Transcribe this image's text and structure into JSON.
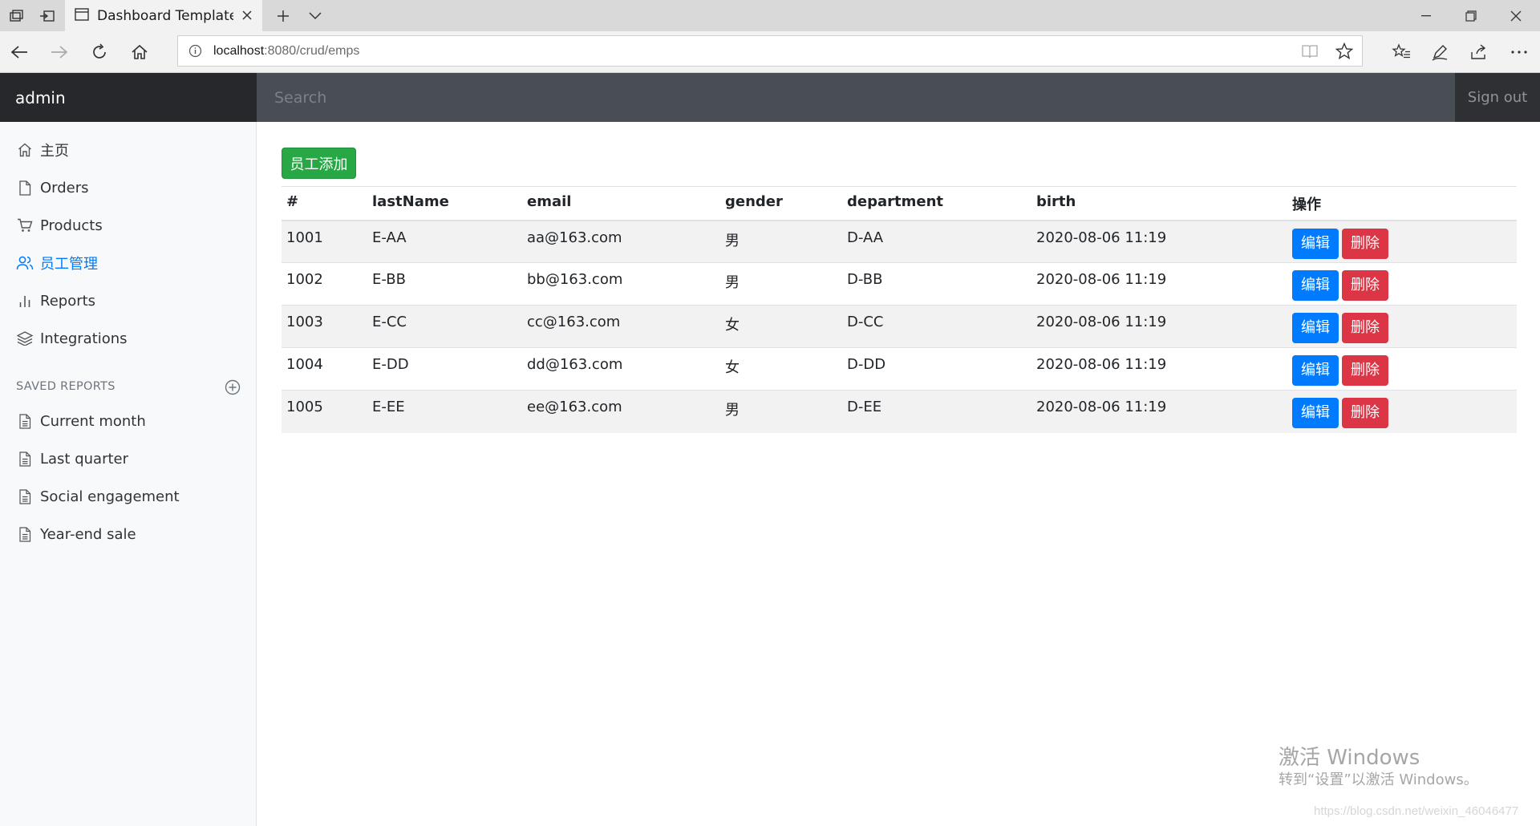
{
  "browser": {
    "tab_title": "Dashboard Template fo",
    "url_host": "localhost",
    "url_path": ":8080/crud/emps"
  },
  "header": {
    "brand": "admin",
    "search_placeholder": "Search",
    "signout": "Sign out"
  },
  "sidebar": {
    "items": [
      {
        "label": "主页",
        "icon": "home-icon"
      },
      {
        "label": "Orders",
        "icon": "file-icon"
      },
      {
        "label": "Products",
        "icon": "cart-icon"
      },
      {
        "label": "员工管理",
        "icon": "users-icon",
        "active": true
      },
      {
        "label": "Reports",
        "icon": "bar-chart-icon"
      },
      {
        "label": "Integrations",
        "icon": "layers-icon"
      }
    ],
    "saved_heading": "SAVED REPORTS",
    "saved": [
      {
        "label": "Current month"
      },
      {
        "label": "Last quarter"
      },
      {
        "label": "Social engagement"
      },
      {
        "label": "Year-end sale"
      }
    ]
  },
  "main": {
    "add_button": "员工添加",
    "columns": [
      "#",
      "lastName",
      "email",
      "gender",
      "department",
      "birth",
      "操作"
    ],
    "rows": [
      {
        "id": "1001",
        "lastName": "E-AA",
        "email": "aa@163.com",
        "gender": "男",
        "department": "D-AA",
        "birth": "2020-08-06 11:19"
      },
      {
        "id": "1002",
        "lastName": "E-BB",
        "email": "bb@163.com",
        "gender": "男",
        "department": "D-BB",
        "birth": "2020-08-06 11:19"
      },
      {
        "id": "1003",
        "lastName": "E-CC",
        "email": "cc@163.com",
        "gender": "女",
        "department": "D-CC",
        "birth": "2020-08-06 11:19"
      },
      {
        "id": "1004",
        "lastName": "E-DD",
        "email": "dd@163.com",
        "gender": "女",
        "department": "D-DD",
        "birth": "2020-08-06 11:19"
      },
      {
        "id": "1005",
        "lastName": "E-EE",
        "email": "ee@163.com",
        "gender": "男",
        "department": "D-EE",
        "birth": "2020-08-06 11:19"
      }
    ],
    "edit_label": "编辑",
    "delete_label": "删除"
  },
  "watermark": {
    "line1": "激活 Windows",
    "line2": "转到“设置”以激活 Windows。",
    "line3": "https://blog.csdn.net/weixin_46046477"
  },
  "colors": {
    "primary": "#007bff",
    "success": "#28a745",
    "danger": "#dc3545",
    "header_bg": "#494d54",
    "brand_bg": "#26282b"
  }
}
